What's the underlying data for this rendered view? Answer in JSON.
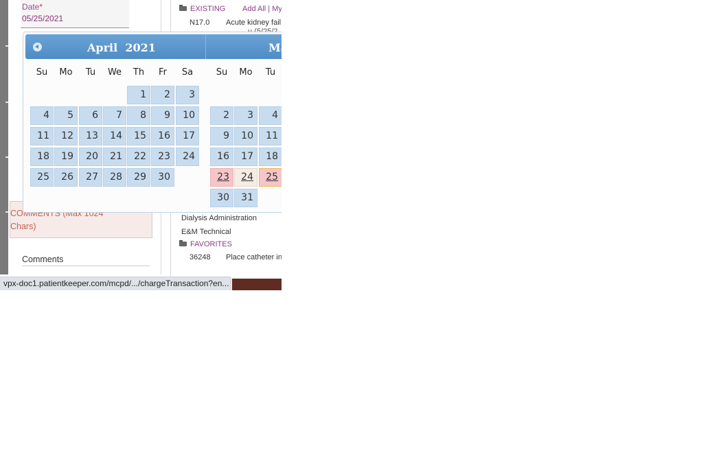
{
  "form": {
    "date_label": "Date",
    "date_required_mark": "*",
    "date_value": "05/25/2021",
    "comments_header": "COMMENTS (Max 1024 Chars)",
    "comments_label": "Comments"
  },
  "right_panel": {
    "existing_label": "EXISTING",
    "add_all_text": "Add All | My",
    "existing_item": {
      "code": "N17.0",
      "desc": "Acute kidney fail"
    },
    "existing_item_sub": "u (5/25/2",
    "dialysis_text": "Dialysis Administration",
    "em_text": "E&M Technical",
    "favorites_label": "FAVORITES",
    "favorite_item": {
      "code": "36248",
      "desc": "Place catheter in"
    }
  },
  "datepicker": {
    "prev_icon": "circle-arrow-left",
    "month1_title": "April  2021",
    "month2_title": "Ma",
    "dow": [
      "Su",
      "Mo",
      "Tu",
      "We",
      "Th",
      "Fr",
      "Sa"
    ],
    "dow_second": [
      "Su",
      "Mo",
      "Tu"
    ],
    "april_days": [
      "",
      "",
      "",
      "",
      "1",
      "2",
      "3",
      "4",
      "5",
      "6",
      "7",
      "8",
      "9",
      "10",
      "11",
      "12",
      "13",
      "14",
      "15",
      "16",
      "17",
      "18",
      "19",
      "20",
      "21",
      "22",
      "23",
      "24",
      "25",
      "26",
      "27",
      "28",
      "29",
      "30",
      ""
    ],
    "may_days": [
      "",
      "",
      "",
      "2",
      "3",
      "4",
      "9",
      "10",
      "11",
      "16",
      "17",
      "18",
      "23",
      "24",
      "25",
      "30",
      "31",
      ""
    ],
    "colors": {
      "header": "#4f8cc6",
      "day_cell": "#c8dcef",
      "highlight_pink": "#f5c5c8",
      "highlight_today": "#f5ece6",
      "selected_border": "#f0b94a"
    }
  },
  "status_bar": {
    "url": "vpx-doc1.patientkeeper.com/mcpd/.../chargeTransaction?en..."
  }
}
